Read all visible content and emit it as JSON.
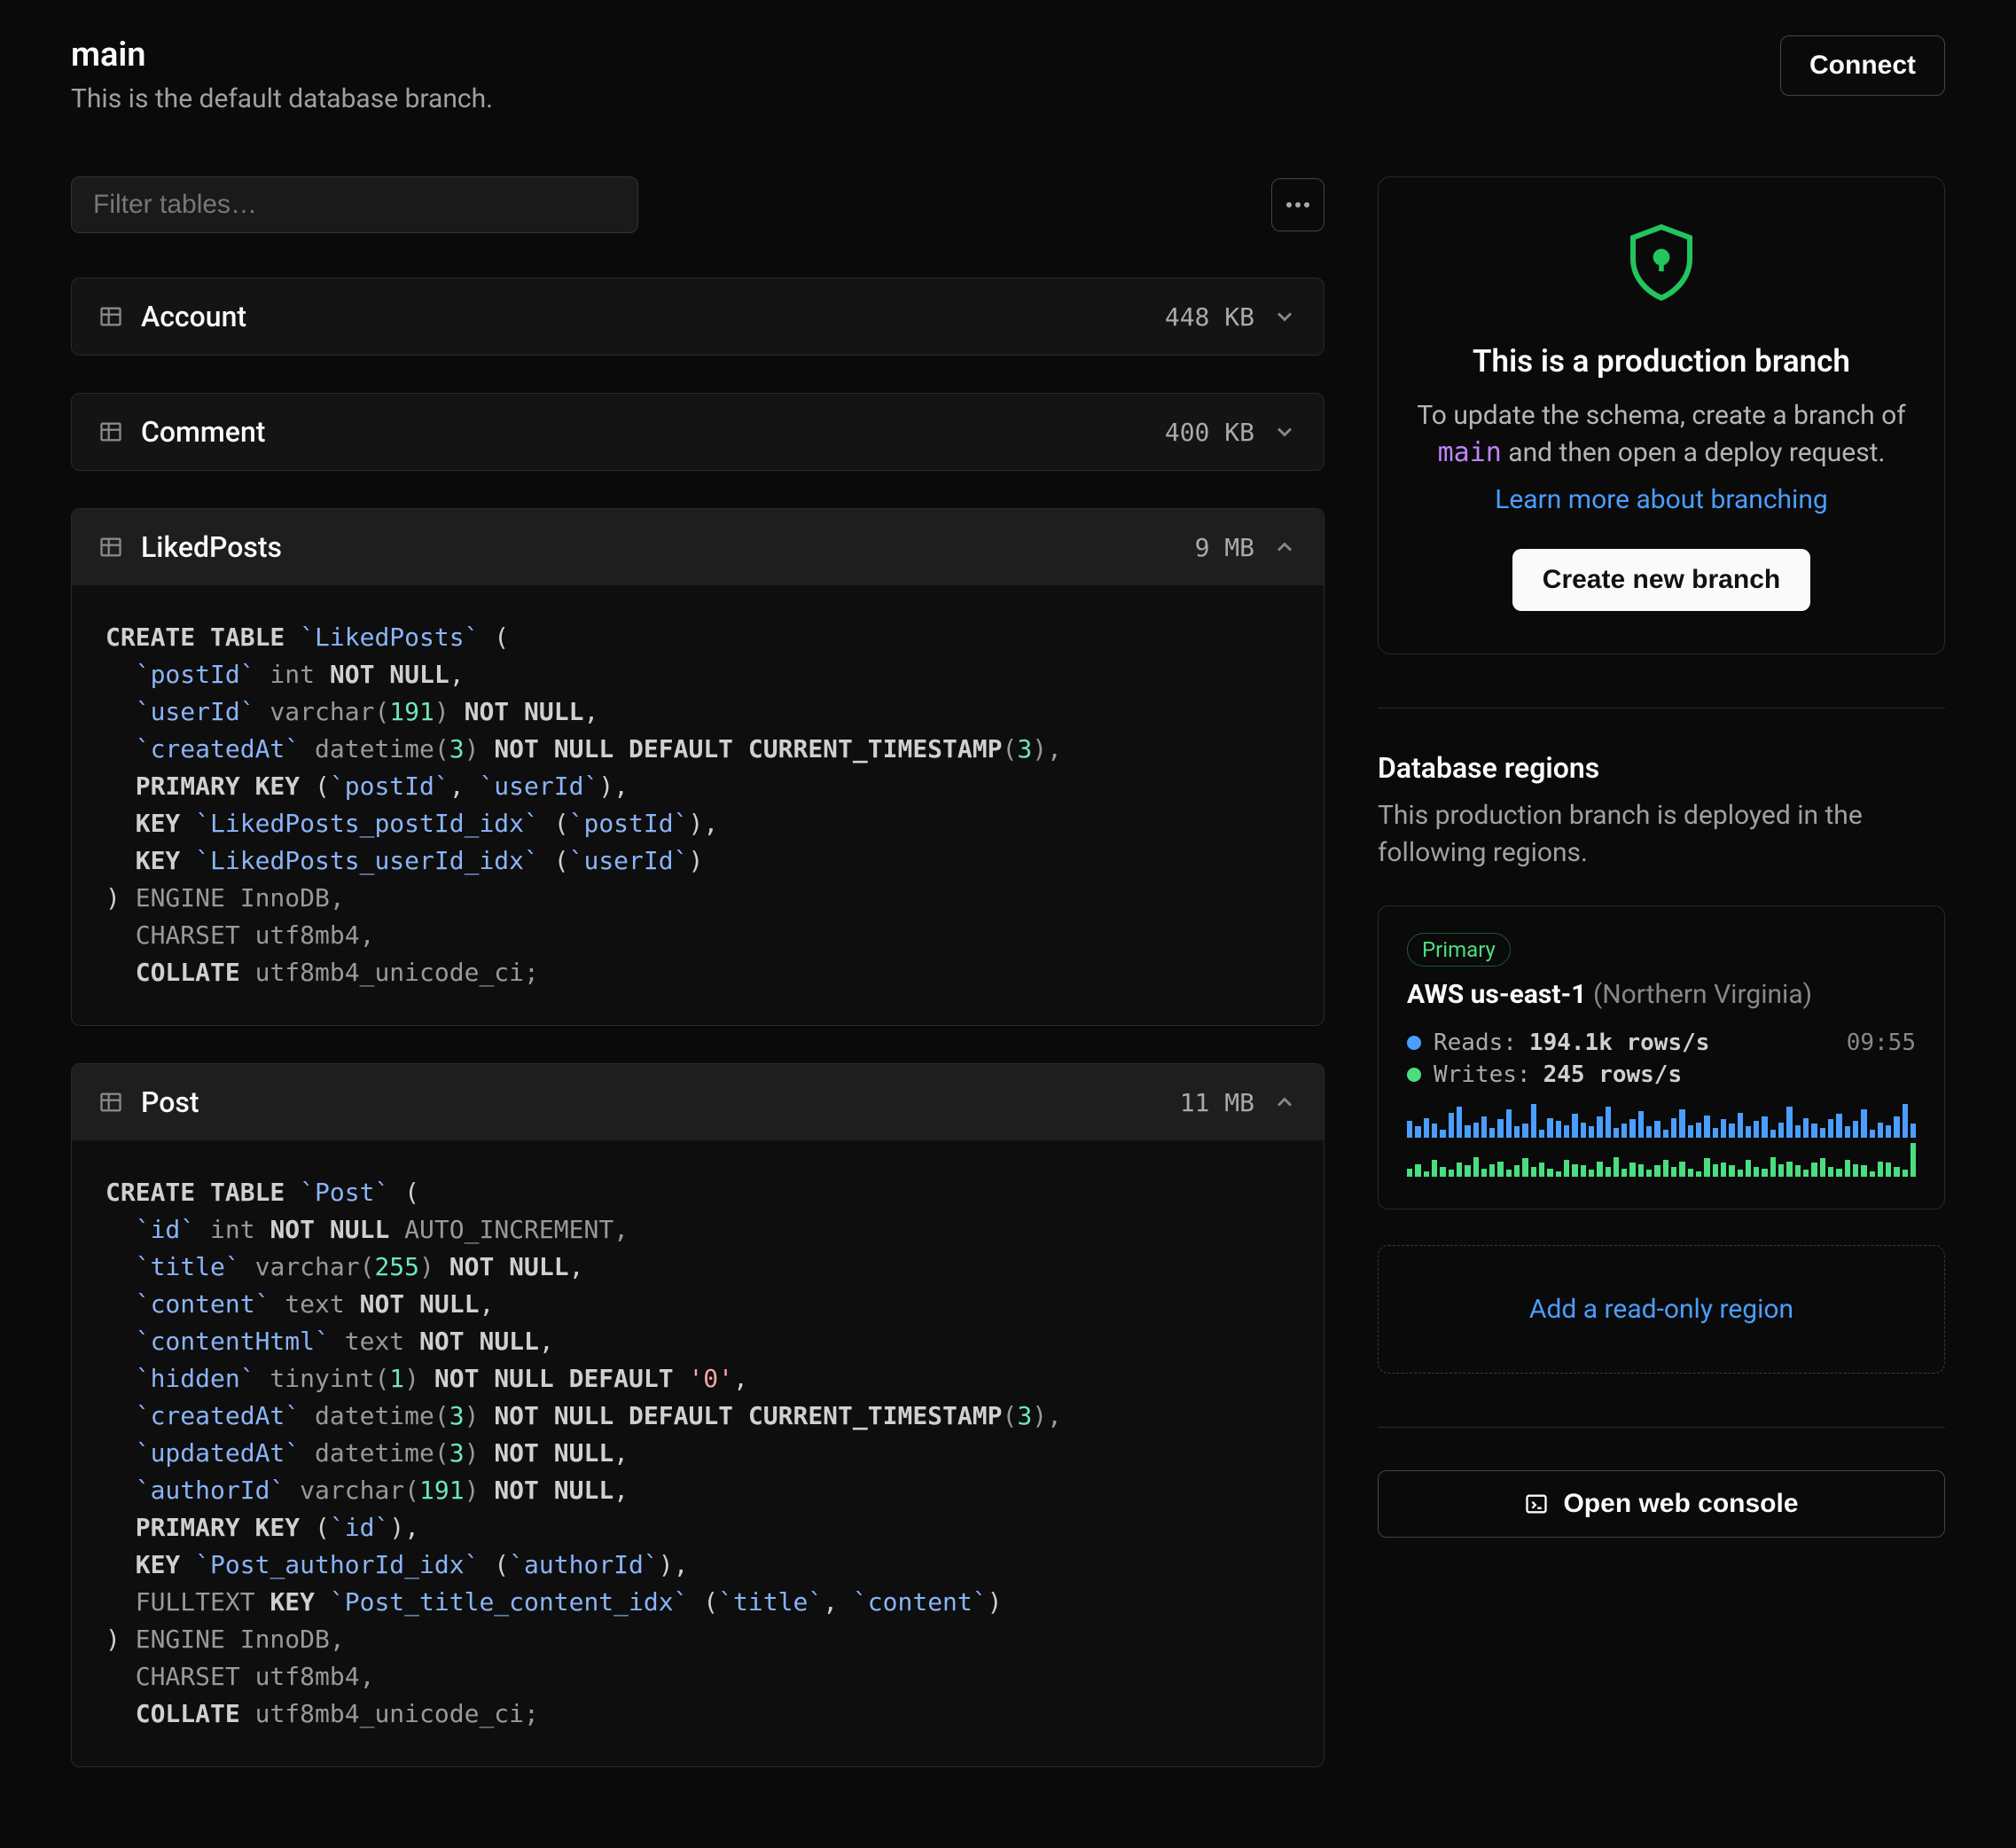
{
  "header": {
    "title": "main",
    "subtitle": "This is the default database branch.",
    "connect": "Connect"
  },
  "filter": {
    "placeholder": "Filter tables…"
  },
  "tables": [
    {
      "name": "Account",
      "size": "448 KB",
      "expanded": false
    },
    {
      "name": "Comment",
      "size": "400 KB",
      "expanded": false
    },
    {
      "name": "LikedPosts",
      "size": "9 MB",
      "expanded": true,
      "sql_key": "likedposts"
    },
    {
      "name": "Post",
      "size": "11 MB",
      "expanded": true,
      "sql_key": "post"
    }
  ],
  "sql": {
    "likedposts": [
      {
        "t": "k",
        "v": "CREATE TABLE "
      },
      {
        "t": "id",
        "v": "`LikedPosts`"
      },
      {
        "t": "",
        "v": " ("
      },
      {
        "t": "br"
      },
      {
        "t": "",
        "v": "  "
      },
      {
        "t": "id",
        "v": "`postId`"
      },
      {
        "t": "d",
        "v": " int "
      },
      {
        "t": "k",
        "v": "NOT NULL"
      },
      {
        "t": "",
        "v": ","
      },
      {
        "t": "br"
      },
      {
        "t": "",
        "v": "  "
      },
      {
        "t": "id",
        "v": "`userId`"
      },
      {
        "t": "d",
        "v": " varchar("
      },
      {
        "t": "n",
        "v": "191"
      },
      {
        "t": "d",
        "v": ") "
      },
      {
        "t": "k",
        "v": "NOT NULL"
      },
      {
        "t": "",
        "v": ","
      },
      {
        "t": "br"
      },
      {
        "t": "",
        "v": "  "
      },
      {
        "t": "id",
        "v": "`createdAt`"
      },
      {
        "t": "d",
        "v": " datetime("
      },
      {
        "t": "n",
        "v": "3"
      },
      {
        "t": "d",
        "v": ") "
      },
      {
        "t": "k",
        "v": "NOT NULL DEFAULT CURRENT_TIMESTAMP"
      },
      {
        "t": "d",
        "v": "("
      },
      {
        "t": "n",
        "v": "3"
      },
      {
        "t": "d",
        "v": "),"
      },
      {
        "t": "br"
      },
      {
        "t": "",
        "v": "  "
      },
      {
        "t": "k",
        "v": "PRIMARY KEY"
      },
      {
        "t": "",
        "v": " ("
      },
      {
        "t": "id",
        "v": "`postId`"
      },
      {
        "t": "",
        "v": ", "
      },
      {
        "t": "id",
        "v": "`userId`"
      },
      {
        "t": "",
        "v": "),"
      },
      {
        "t": "br"
      },
      {
        "t": "",
        "v": "  "
      },
      {
        "t": "k",
        "v": "KEY"
      },
      {
        "t": "",
        "v": " "
      },
      {
        "t": "id",
        "v": "`LikedPosts_postId_idx`"
      },
      {
        "t": "",
        "v": " ("
      },
      {
        "t": "id",
        "v": "`postId`"
      },
      {
        "t": "",
        "v": "),"
      },
      {
        "t": "br"
      },
      {
        "t": "",
        "v": "  "
      },
      {
        "t": "k",
        "v": "KEY"
      },
      {
        "t": "",
        "v": " "
      },
      {
        "t": "id",
        "v": "`LikedPosts_userId_idx`"
      },
      {
        "t": "",
        "v": " ("
      },
      {
        "t": "id",
        "v": "`userId`"
      },
      {
        "t": "",
        "v": ")"
      },
      {
        "t": "br"
      },
      {
        "t": "",
        "v": ") "
      },
      {
        "t": "d",
        "v": "ENGINE InnoDB,"
      },
      {
        "t": "br"
      },
      {
        "t": "d",
        "v": "  CHARSET utf8mb4,"
      },
      {
        "t": "br"
      },
      {
        "t": "",
        "v": "  "
      },
      {
        "t": "k",
        "v": "COLLATE"
      },
      {
        "t": "d",
        "v": " utf8mb4_unicode_ci;"
      }
    ],
    "post": [
      {
        "t": "k",
        "v": "CREATE TABLE "
      },
      {
        "t": "id",
        "v": "`Post`"
      },
      {
        "t": "",
        "v": " ("
      },
      {
        "t": "br"
      },
      {
        "t": "",
        "v": "  "
      },
      {
        "t": "id",
        "v": "`id`"
      },
      {
        "t": "d",
        "v": " int "
      },
      {
        "t": "k",
        "v": "NOT NULL"
      },
      {
        "t": "d",
        "v": " AUTO_INCREMENT,"
      },
      {
        "t": "br"
      },
      {
        "t": "",
        "v": "  "
      },
      {
        "t": "id",
        "v": "`title`"
      },
      {
        "t": "d",
        "v": " varchar("
      },
      {
        "t": "n",
        "v": "255"
      },
      {
        "t": "d",
        "v": ") "
      },
      {
        "t": "k",
        "v": "NOT NULL"
      },
      {
        "t": "",
        "v": ","
      },
      {
        "t": "br"
      },
      {
        "t": "",
        "v": "  "
      },
      {
        "t": "id",
        "v": "`content`"
      },
      {
        "t": "d",
        "v": " text "
      },
      {
        "t": "k",
        "v": "NOT NULL"
      },
      {
        "t": "",
        "v": ","
      },
      {
        "t": "br"
      },
      {
        "t": "",
        "v": "  "
      },
      {
        "t": "id",
        "v": "`contentHtml`"
      },
      {
        "t": "d",
        "v": " text "
      },
      {
        "t": "k",
        "v": "NOT NULL"
      },
      {
        "t": "",
        "v": ","
      },
      {
        "t": "br"
      },
      {
        "t": "",
        "v": "  "
      },
      {
        "t": "id",
        "v": "`hidden`"
      },
      {
        "t": "d",
        "v": " tinyint("
      },
      {
        "t": "n",
        "v": "1"
      },
      {
        "t": "d",
        "v": ") "
      },
      {
        "t": "k",
        "v": "NOT NULL DEFAULT "
      },
      {
        "t": "s",
        "v": "'0'"
      },
      {
        "t": "",
        "v": ","
      },
      {
        "t": "br"
      },
      {
        "t": "",
        "v": "  "
      },
      {
        "t": "id",
        "v": "`createdAt`"
      },
      {
        "t": "d",
        "v": " datetime("
      },
      {
        "t": "n",
        "v": "3"
      },
      {
        "t": "d",
        "v": ") "
      },
      {
        "t": "k",
        "v": "NOT NULL DEFAULT CURRENT_TIMESTAMP"
      },
      {
        "t": "d",
        "v": "("
      },
      {
        "t": "n",
        "v": "3"
      },
      {
        "t": "d",
        "v": "),"
      },
      {
        "t": "br"
      },
      {
        "t": "",
        "v": "  "
      },
      {
        "t": "id",
        "v": "`updatedAt`"
      },
      {
        "t": "d",
        "v": " datetime("
      },
      {
        "t": "n",
        "v": "3"
      },
      {
        "t": "d",
        "v": ") "
      },
      {
        "t": "k",
        "v": "NOT NULL"
      },
      {
        "t": "",
        "v": ","
      },
      {
        "t": "br"
      },
      {
        "t": "",
        "v": "  "
      },
      {
        "t": "id",
        "v": "`authorId`"
      },
      {
        "t": "d",
        "v": " varchar("
      },
      {
        "t": "n",
        "v": "191"
      },
      {
        "t": "d",
        "v": ") "
      },
      {
        "t": "k",
        "v": "NOT NULL"
      },
      {
        "t": "",
        "v": ","
      },
      {
        "t": "br"
      },
      {
        "t": "",
        "v": "  "
      },
      {
        "t": "k",
        "v": "PRIMARY KEY"
      },
      {
        "t": "",
        "v": " ("
      },
      {
        "t": "id",
        "v": "`id`"
      },
      {
        "t": "",
        "v": "),"
      },
      {
        "t": "br"
      },
      {
        "t": "",
        "v": "  "
      },
      {
        "t": "k",
        "v": "KEY"
      },
      {
        "t": "",
        "v": " "
      },
      {
        "t": "id",
        "v": "`Post_authorId_idx`"
      },
      {
        "t": "",
        "v": " ("
      },
      {
        "t": "id",
        "v": "`authorId`"
      },
      {
        "t": "",
        "v": "),"
      },
      {
        "t": "br"
      },
      {
        "t": "",
        "v": "  "
      },
      {
        "t": "d",
        "v": "FULLTEXT "
      },
      {
        "t": "k",
        "v": "KEY"
      },
      {
        "t": "",
        "v": " "
      },
      {
        "t": "id",
        "v": "`Post_title_content_idx`"
      },
      {
        "t": "",
        "v": " ("
      },
      {
        "t": "id",
        "v": "`title`"
      },
      {
        "t": "",
        "v": ", "
      },
      {
        "t": "id",
        "v": "`content`"
      },
      {
        "t": "",
        "v": ")"
      },
      {
        "t": "br"
      },
      {
        "t": "",
        "v": ") "
      },
      {
        "t": "d",
        "v": "ENGINE InnoDB,"
      },
      {
        "t": "br"
      },
      {
        "t": "d",
        "v": "  CHARSET utf8mb4,"
      },
      {
        "t": "br"
      },
      {
        "t": "",
        "v": "  "
      },
      {
        "t": "k",
        "v": "COLLATE"
      },
      {
        "t": "d",
        "v": " utf8mb4_unicode_ci;"
      }
    ]
  },
  "production": {
    "title": "This is a production branch",
    "desc_pre": "To update the schema, create a branch of ",
    "branch": "main",
    "desc_post": " and then open a deploy request.",
    "learn": "Learn more about branching",
    "create": "Create new branch"
  },
  "regions": {
    "title": "Database regions",
    "desc": "This production branch is deployed in the following regions.",
    "badge": "Primary",
    "name": "AWS us-east-1",
    "location": "(Northern Virginia)",
    "reads_label": "Reads:",
    "reads_value": "194.1k rows/s",
    "time": "09:55",
    "writes_label": "Writes:",
    "writes_value": "245 rows/s",
    "add": "Add a read-only region",
    "spark_reads": [
      12,
      8,
      14,
      10,
      6,
      18,
      22,
      9,
      11,
      15,
      7,
      13,
      20,
      8,
      10,
      24,
      6,
      14,
      12,
      9,
      17,
      11,
      8,
      15,
      22,
      7,
      10,
      13,
      19,
      8,
      12,
      6,
      14,
      20,
      9,
      11,
      16,
      7,
      13,
      10,
      18,
      8,
      12,
      15,
      6,
      11,
      22,
      9,
      14,
      10,
      7,
      13,
      17,
      8,
      12,
      20,
      6,
      11,
      9,
      15,
      24,
      10
    ],
    "spark_writes": [
      6,
      9,
      4,
      12,
      7,
      5,
      10,
      8,
      14,
      6,
      9,
      11,
      5,
      8,
      13,
      7,
      10,
      6,
      4,
      12,
      9,
      8,
      5,
      11,
      7,
      14,
      6,
      10,
      9,
      5,
      8,
      12,
      7,
      11,
      6,
      4,
      13,
      9,
      10,
      8,
      5,
      12,
      7,
      6,
      14,
      9,
      11,
      8,
      5,
      10,
      13,
      7,
      6,
      12,
      9,
      8,
      4,
      11,
      10,
      7,
      5,
      24
    ]
  },
  "console": "Open web console"
}
